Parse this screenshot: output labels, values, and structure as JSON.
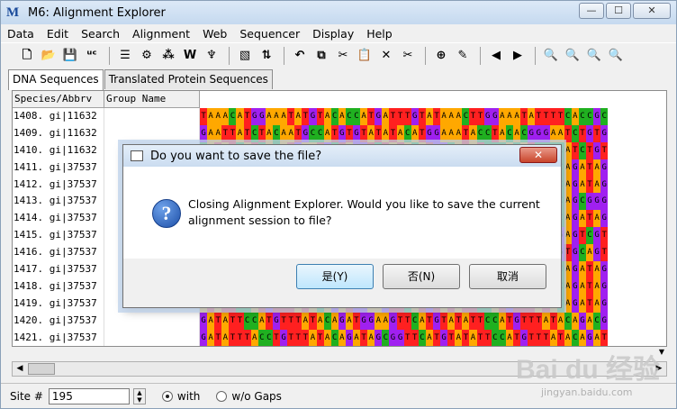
{
  "window": {
    "title": "M6: Alignment Explorer",
    "controls": [
      "—",
      "☐",
      "✕"
    ]
  },
  "menu": [
    "Data",
    "Edit",
    "Search",
    "Alignment",
    "Web",
    "Sequencer",
    "Display",
    "Help"
  ],
  "toolbar": {
    "groups": [
      [
        {
          "name": "new-file-icon",
          "glyph": "🗋"
        },
        {
          "name": "open-folder-icon",
          "glyph": "📂"
        },
        {
          "name": "save-icon",
          "glyph": "💾"
        },
        {
          "name": "nuc-icon",
          "glyph": "ᵘᶜ"
        }
      ],
      [
        {
          "name": "align-icon",
          "glyph": "☰"
        },
        {
          "name": "protein-align-icon",
          "glyph": "⚙"
        },
        {
          "name": "atgc-icon",
          "glyph": "⁂"
        },
        {
          "name": "w-align-icon",
          "glyph": "W"
        },
        {
          "name": "muscle-icon",
          "glyph": "♆"
        }
      ],
      [
        {
          "name": "highlight-icon",
          "glyph": "▧"
        },
        {
          "name": "column-icon",
          "glyph": "⇅"
        }
      ],
      [
        {
          "name": "undo-icon",
          "glyph": "↶"
        },
        {
          "name": "copy-icon",
          "glyph": "⧉"
        },
        {
          "name": "cut-icon",
          "glyph": "✂"
        },
        {
          "name": "paste-icon",
          "glyph": "📋"
        },
        {
          "name": "delete-icon",
          "glyph": "✕"
        },
        {
          "name": "delete-gap-icon",
          "glyph": "✂"
        }
      ],
      [
        {
          "name": "insert-icon",
          "glyph": "⊕"
        },
        {
          "name": "edit-icon",
          "glyph": "✎"
        }
      ],
      [
        {
          "name": "move-left-icon",
          "glyph": "◀"
        },
        {
          "name": "move-right-icon",
          "glyph": "▶"
        }
      ],
      [
        {
          "name": "find-icon",
          "glyph": "🔍"
        },
        {
          "name": "find-previous-icon",
          "glyph": "🔍"
        },
        {
          "name": "find-next-icon",
          "glyph": "🔍"
        },
        {
          "name": "find-motif-icon",
          "glyph": "🔍"
        }
      ]
    ]
  },
  "tabs": [
    {
      "label": "DNA Sequences",
      "active": true
    },
    {
      "label": "Translated Protein Sequences",
      "active": false
    }
  ],
  "grid": {
    "headers": [
      "Species/Abbrv",
      "Group Name"
    ],
    "rows": [
      {
        "label": "1408. gi|11632",
        "seq": "TAAACATGGAAATATGTACACCATGATTTGTATAAACTTGGAAATATTTTCACCGC"
      },
      {
        "label": "1409. gi|11632",
        "seq": "GAATTATCTACAATGCCATGTGTATATACATGGAAATACCTACACGGGAATCTGTG"
      },
      {
        "label": "1410. gi|11632",
        "seq": "CATATCATCACATGAATGCTAGGTCTATACATGGCATATCCCACATCCCCATCTGT"
      },
      {
        "label": "1411. gi|37537",
        "seq": "ATATTCCATGTTTATACAGATGGAAGTTCATGTATATTCCATGTTTATACAGATAG"
      },
      {
        "label": "1412. gi|37537",
        "seq": "GTATTCCATGTTTATACAGATGGCAGTTCATGTATATTCCATGTTTATACAGATAG"
      },
      {
        "label": "1413. gi|37537",
        "seq": "ATATTCCATGTTTATACAGATGGAAGTTCATGTATATTCCATGTTTATACAGCGGG"
      },
      {
        "label": "1414. gi|37537",
        "seq": "ATATTCCATGTTTATACAGATGGAAGTTCATGTATATTCCATGTTTATACAGATAG"
      },
      {
        "label": "1415. gi|37537",
        "seq": "GTATTCCATGTTTATACAGATGGCAGTTCATGTATATTCCATGTTTACAGAGTCGT"
      },
      {
        "label": "1416. gi|37537",
        "seq": "ATATTCCATGTTTATACAGATGGAAGTTCATGTATATTCCATGTTTAGAGTGCAGT"
      },
      {
        "label": "1417. gi|37537",
        "seq": "ATATTCCATGTTTATACAGATGGAAGTTCATGTATATTCCATGTTTATACAGATAG"
      },
      {
        "label": "1418. gi|37537",
        "seq": "GTATTCCATGTTTATACAGATGGCAGTTCATGTATATTCCATGTTTATACAGATAG"
      },
      {
        "label": "1419. gi|37537",
        "seq": "ATATTCCATGTTTATACAGATGGAAGTTCATGTATATTCCATGTTTATACAGATAG"
      },
      {
        "label": "1420. gi|37537",
        "seq": "GATATTCCATGTTTATACAGATGGAAGTTCATGTATATTCCATGTTTATACAGACG"
      },
      {
        "label": "1421. gi|37537",
        "seq": "GATATTTACCTGTTTATACAGATAGCGGTTCATGTATATTCCATGTTTATACAGAT"
      }
    ]
  },
  "status": {
    "site_label": "Site #",
    "site_value": "195",
    "with_label": "with",
    "without_label": "w/o Gaps"
  },
  "dialog": {
    "title": "Do you want to save the file?",
    "message": "Closing Alignment Explorer. Would you like to save the current alignment session to file?",
    "yes": "是(Y)",
    "no": "否(N)",
    "cancel": "取消"
  },
  "watermark": {
    "main": "Bai du 经验",
    "sub": "jingyan.baidu.com"
  },
  "colors": {
    "A": "#ffa800",
    "T": "#ff2020",
    "G": "#a020f0",
    "C": "#20b020"
  }
}
